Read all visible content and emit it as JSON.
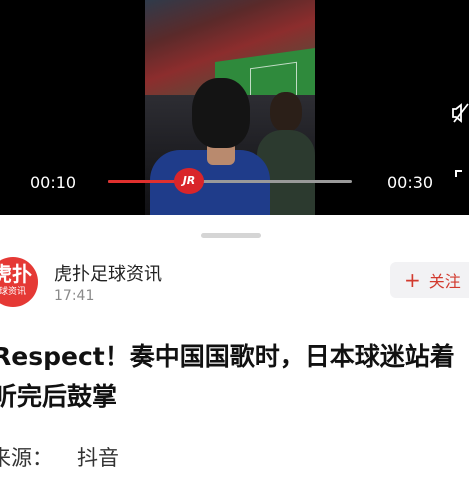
{
  "video": {
    "current_time": "00:10",
    "duration": "00:30",
    "progress_fraction": 0.33,
    "thumb_label": "JR",
    "accent_color": "#e0302e"
  },
  "article": {
    "author": "虎扑足球资讯",
    "avatar_text": "虎扑",
    "avatar_sub": "足球资讯",
    "post_time": "17:41",
    "follow_label": "关注",
    "follow_icon": "plus-icon",
    "title": "Respect！奏中国国歌时，日本球迷站着听完后鼓掌",
    "source_label": "来源：",
    "source_value": "抖音"
  }
}
